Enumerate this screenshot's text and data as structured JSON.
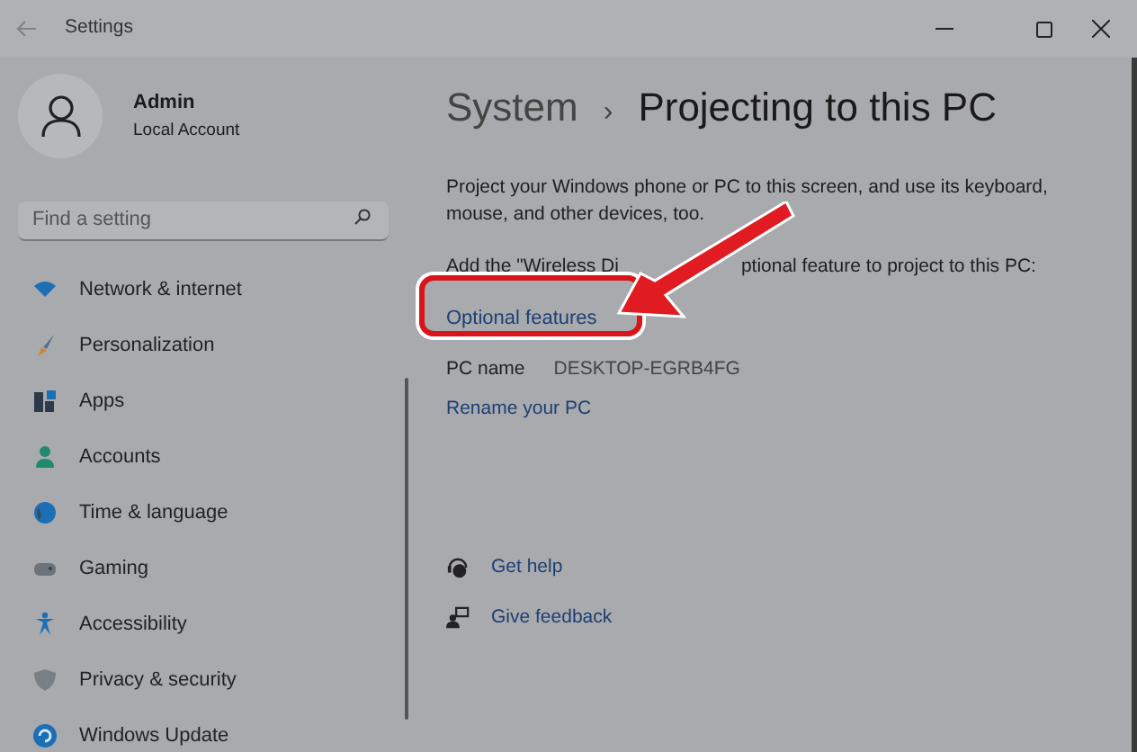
{
  "window": {
    "title": "Settings"
  },
  "account": {
    "name": "Admin",
    "type": "Local Account"
  },
  "search": {
    "placeholder": "Find a setting"
  },
  "sidebar": {
    "items": [
      {
        "label": "Network & internet",
        "kind": "wifi"
      },
      {
        "label": "Personalization",
        "kind": "brush"
      },
      {
        "label": "Apps",
        "kind": "apps"
      },
      {
        "label": "Accounts",
        "kind": "person"
      },
      {
        "label": "Time & language",
        "kind": "globe"
      },
      {
        "label": "Gaming",
        "kind": "gamepad"
      },
      {
        "label": "Accessibility",
        "kind": "accessibility"
      },
      {
        "label": "Privacy & security",
        "kind": "shield"
      },
      {
        "label": "Windows Update",
        "kind": "update"
      }
    ]
  },
  "breadcrumb": {
    "parent": "System",
    "separator": "›",
    "current": "Projecting to this PC"
  },
  "description": "Project your Windows phone or PC to this screen, and use its keyboard, mouse, and other devices, too.",
  "feature_line": [
    "Add the \"Wireless Di",
    "ptional feature to project to this PC:"
  ],
  "feature_link": "Optional features",
  "pc_name": {
    "label": "PC name",
    "value": "DESKTOP-EGRB4FG"
  },
  "rename_link": "Rename your PC",
  "help_links": [
    {
      "label": "Get help",
      "kind": "help"
    },
    {
      "label": "Give feedback",
      "kind": "feedback"
    }
  ]
}
